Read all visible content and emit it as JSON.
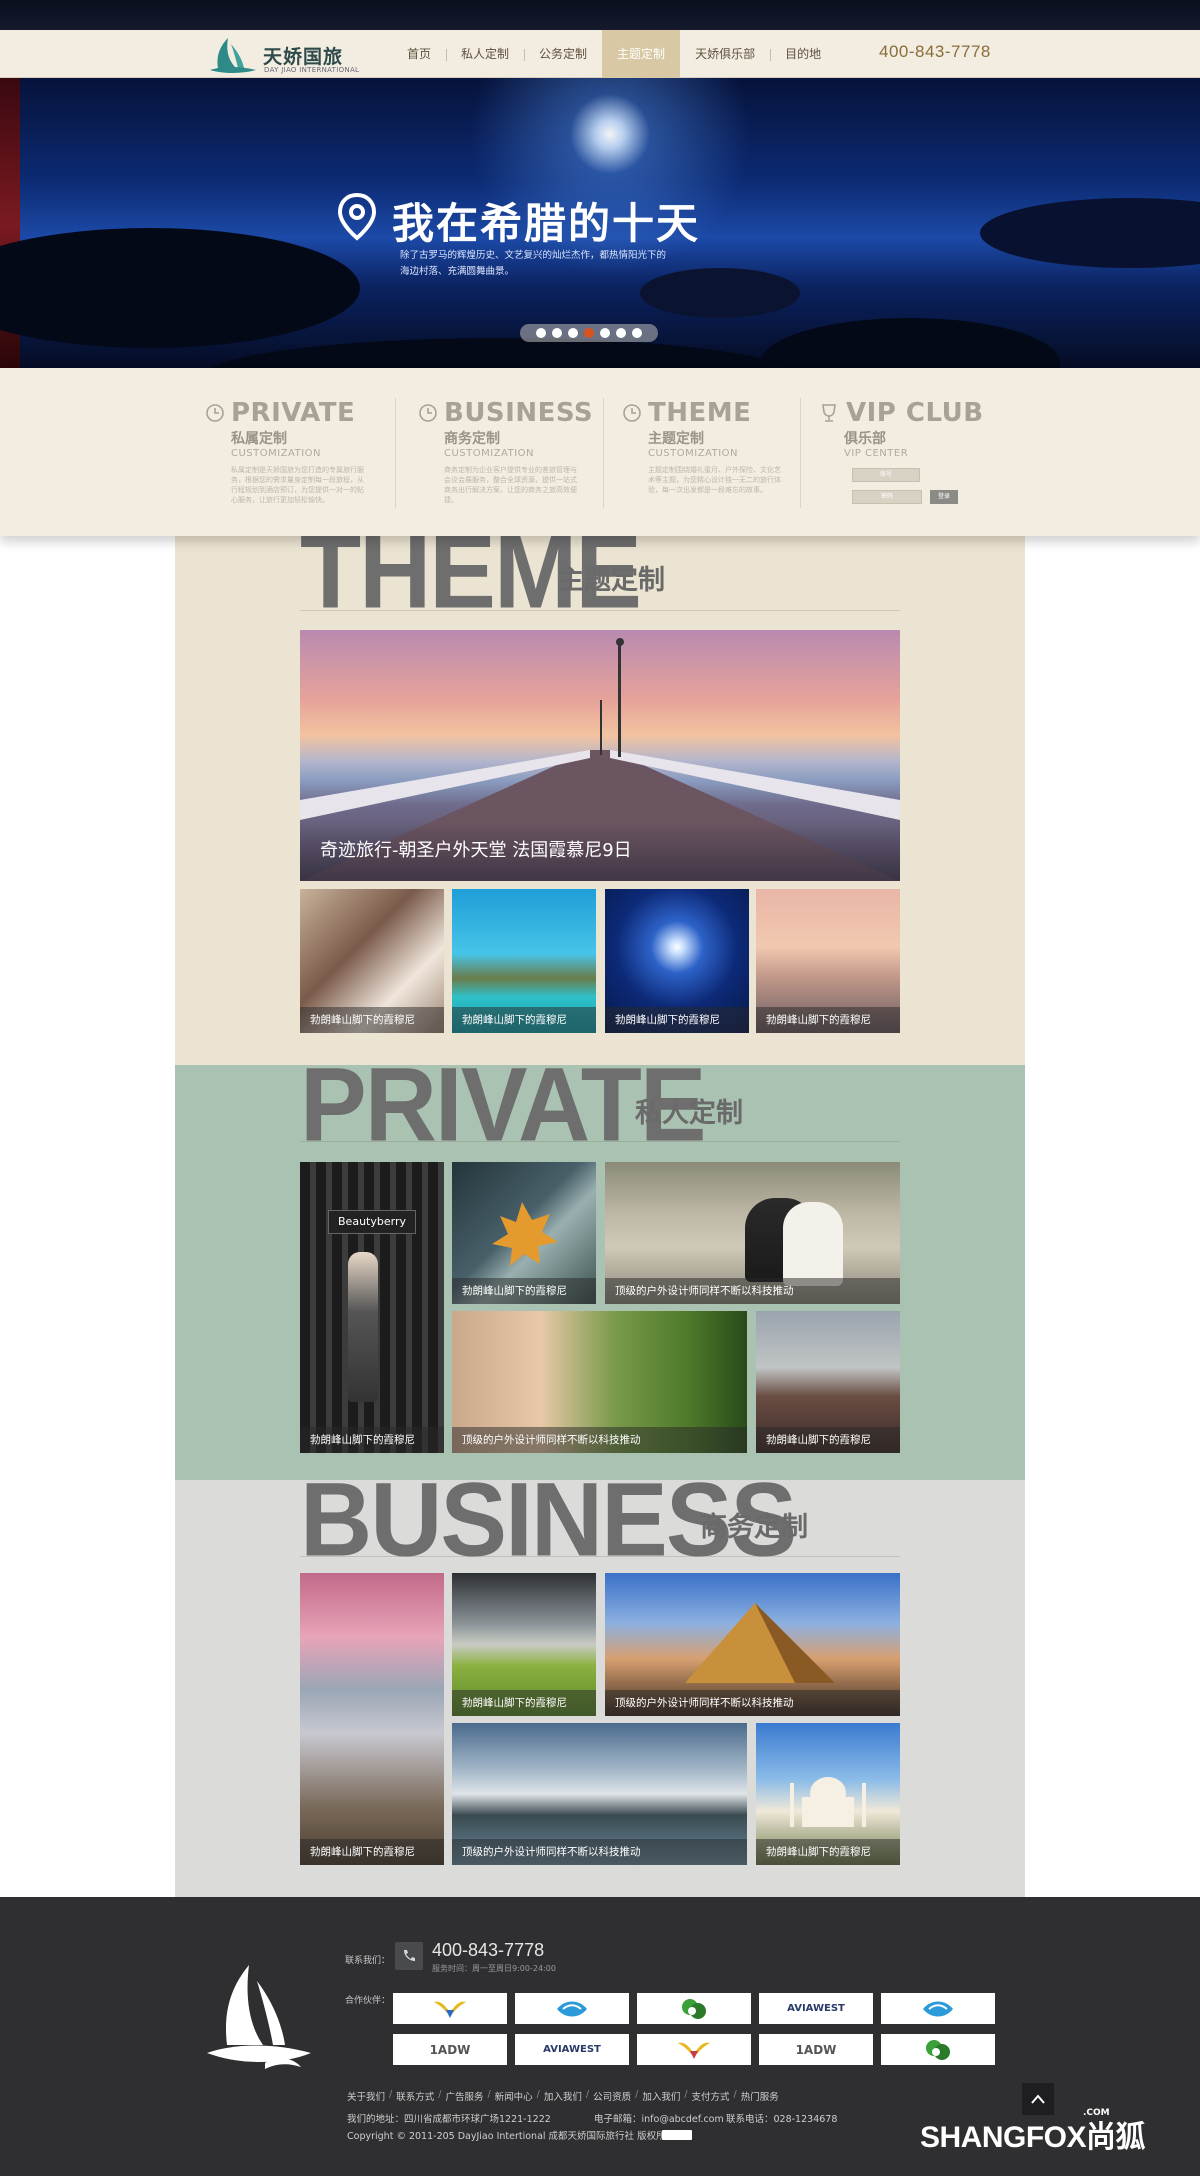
{
  "brand": {
    "name_cn": "天娇国旅",
    "name_en": "DAY JIAO INTERNATIONAL"
  },
  "nav": {
    "items": [
      "首页",
      "私人定制",
      "公务定制",
      "主题定制",
      "天娇俱乐部",
      "目的地"
    ],
    "active_index": 3,
    "phone": "400-843-7778"
  },
  "banner": {
    "title": "我在希腊的十天",
    "description": "除了古罗马的辉煌历史、文艺复兴的灿烂杰作，都热情阳光下的海边村落、充满圆舞曲景。",
    "slide_count": 7,
    "active_slide": 3
  },
  "categories": [
    {
      "title": "PRIVATE",
      "cn": "私属定制",
      "en": "CUSTOMIZATION",
      "icon": "clock-icon",
      "desc": "私属定制是天娇国旅为您打造的专属旅行服务，根据您的需求量身定制每一段旅程，从行程规划到酒店预订，为您提供一对一的贴心服务，让旅行更加轻松愉快。"
    },
    {
      "title": "BUSINESS",
      "cn": "商务定制",
      "en": "CUSTOMIZATION",
      "icon": "clock-icon",
      "desc": "商务定制为企业客户提供专业的差旅管理与会议会展服务，整合全球资源，提供一站式商务出行解决方案，让您的商务之旅高效便捷。"
    },
    {
      "title": "THEME",
      "cn": "主题定制",
      "en": "CUSTOMIZATION",
      "icon": "clock-icon",
      "desc": "主题定制围绕婚礼蜜月、户外探险、文化艺术等主题，为您精心设计独一无二的旅行体验，每一次出发都是一段难忘的故事。"
    },
    {
      "title": "VIP CLUB",
      "cn": "俱乐部",
      "en": "VIP CENTER",
      "icon": "trophy-icon",
      "desc": ""
    }
  ],
  "vip": {
    "field1": "账号",
    "field2": "密码",
    "login_label": "登录"
  },
  "theme_section": {
    "big": "THEME",
    "cn": "主题定制",
    "featured": "奇迹旅行-朝圣户外天堂 法国霞慕尼9日",
    "tiles": [
      "勃朗峰山脚下的霞穆尼",
      "勃朗峰山脚下的霞穆尼",
      "勃朗峰山脚下的霞穆尼",
      "勃朗峰山脚下的霞穆尼"
    ]
  },
  "private_section": {
    "big": "PRIVATE",
    "cn": "私人定制",
    "tile_tall": "勃朗峰山脚下的霞穆尼",
    "tile_leaf": "勃朗峰山脚下的霞穆尼",
    "tile_couple": "顶级的户外设计师同样不断以科技推动",
    "tile_bride": "顶级的户外设计师同样不断以科技推动",
    "tile_rocks": "勃朗峰山脚下的霞穆尼",
    "poster_brand": "Beautyberry"
  },
  "business_section": {
    "big": "BUSINESS",
    "cn": "商务定制",
    "tile_tall": "勃朗峰山脚下的霞穆尼",
    "tile_field": "勃朗峰山脚下的霞穆尼",
    "tile_louvre": "顶级的户外设计师同样不断以科技推动",
    "tile_coast": "顶级的户外设计师同样不断以科技推动",
    "tile_taj": "勃朗峰山脚下的霞穆尼"
  },
  "footer": {
    "contact_label": "联系我们：",
    "phone": "400-843-7778",
    "hours": "服务时间：周一至周日9:00-24:00",
    "partners_label": "合作伙伴：",
    "partners": [
      "bird-logo",
      "wave-logo",
      "leaf-logo",
      "AVIAWEST",
      "wave-logo",
      "1ADW",
      "AVIAWEST",
      "bird-logo",
      "1ADW",
      "leaf-logo"
    ],
    "links": [
      "关于我们",
      "联系方式",
      "广告服务",
      "新闻中心",
      "加入我们",
      "公司资质",
      "加入我们",
      "支付方式",
      "热门服务"
    ],
    "address": "我们的地址：四川省成都市环球广场1221-1222",
    "email": "电子邮箱：info@abcdef.com",
    "tel": "联系电话：028-1234678",
    "copyright": "Copyright © 2011-205 DayJiao Intertional 成都天娇国际旅行社 版权所有"
  },
  "watermark": {
    "text": "SHANGFOX尚狐",
    "suffix": ".COM"
  },
  "colors": {
    "nav_bg": "#f2ede0",
    "nav_active": "#d8c8a4",
    "theme_bg": "#ece4d2",
    "private_bg": "#a9c2b1",
    "business_bg": "#dbdbd9",
    "footer_bg": "#2f2f31"
  }
}
